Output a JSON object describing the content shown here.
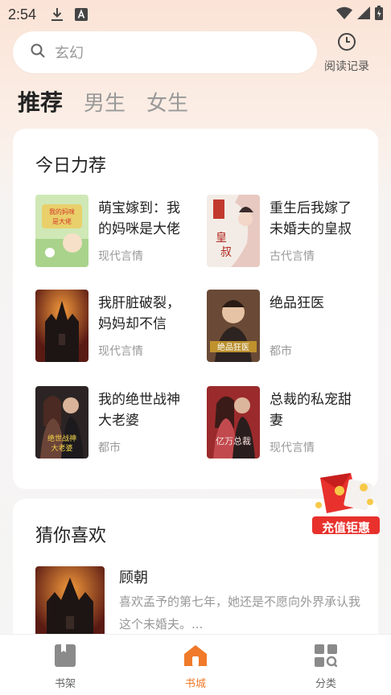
{
  "status_bar": {
    "time": "2:54"
  },
  "search": {
    "placeholder": "玄幻"
  },
  "history": {
    "label": "阅读记录"
  },
  "tabs": [
    {
      "label": "推荐"
    },
    {
      "label": "男生"
    },
    {
      "label": "女生"
    }
  ],
  "today": {
    "title": "今日力荐",
    "books": [
      {
        "title": "萌宝嫁到：我的妈咪是大佬",
        "genre": "现代言情",
        "cover_text": "我的妈咪是大佬"
      },
      {
        "title": "重生后我嫁了未婚夫的皇叔",
        "genre": "古代言情",
        "cover_text": "皇叔"
      },
      {
        "title": "我肝脏破裂，妈妈却不信",
        "genre": "现代言情",
        "cover_text": ""
      },
      {
        "title": "绝品狂医",
        "genre": "都市",
        "cover_text": "绝品狂医"
      },
      {
        "title": "我的绝世战神大老婆",
        "genre": "都市",
        "cover_text": "绝世战神大老婆"
      },
      {
        "title": "总裁的私宠甜妻",
        "genre": "现代言情",
        "cover_text": "亿万总裁"
      }
    ]
  },
  "guess": {
    "title": "猜你喜欢",
    "book": {
      "title": "顾朝",
      "desc": "喜欢孟予的第七年，她还是不愿向外界承认我这个未婚夫。..."
    }
  },
  "promo": {
    "label": "充值钜惠"
  },
  "bottom_nav": [
    {
      "label": "书架"
    },
    {
      "label": "书城"
    },
    {
      "label": "分类"
    }
  ],
  "colors": {
    "accent": "#f07a2a",
    "promo": "#e8312c"
  }
}
